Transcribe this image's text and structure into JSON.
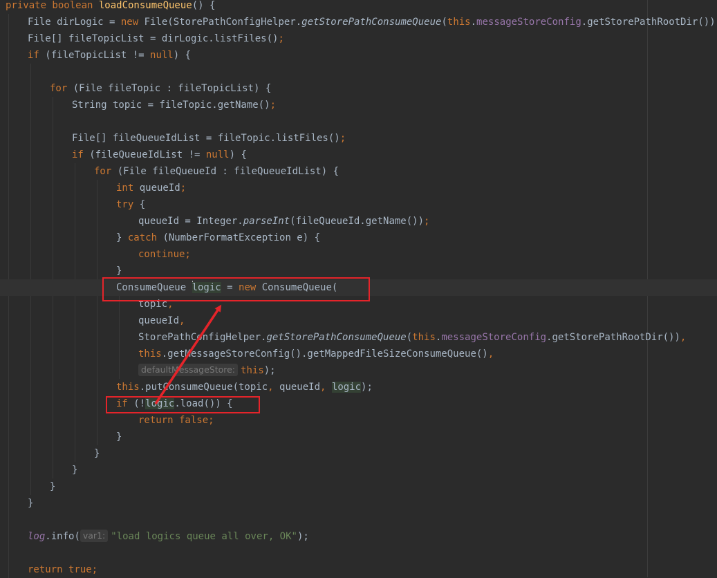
{
  "editor": {
    "lines": [
      {
        "indent": 0,
        "tokens": [
          [
            "private boolean ",
            "kw"
          ],
          [
            "loadConsumeQueue",
            "fn"
          ],
          [
            "() {",
            ""
          ]
        ]
      },
      {
        "indent": 1,
        "tokens": [
          [
            "File dirLogic = ",
            ""
          ],
          [
            "new ",
            "kw"
          ],
          [
            "File(StorePathConfigHelper.",
            ""
          ],
          [
            "getStorePathConsumeQueue",
            "it"
          ],
          [
            "(",
            ""
          ],
          [
            "this",
            "kw"
          ],
          [
            ".",
            ""
          ],
          [
            "messageStoreConfig",
            "fld"
          ],
          [
            ".getStorePathRootDir()));",
            ""
          ]
        ]
      },
      {
        "indent": 1,
        "tokens": [
          [
            "File[] fileTopicList = dirLogic.listFiles()",
            ""
          ],
          [
            ";",
            "kw"
          ]
        ]
      },
      {
        "indent": 1,
        "tokens": [
          [
            "if ",
            "kw"
          ],
          [
            "(fileTopicList != ",
            ""
          ],
          [
            "null",
            "kw"
          ],
          [
            ") {",
            ""
          ]
        ]
      },
      {
        "indent": 0,
        "tokens": []
      },
      {
        "indent": 2,
        "tokens": [
          [
            "for ",
            "kw"
          ],
          [
            "(File fileTopic : fileTopicList) {",
            ""
          ]
        ]
      },
      {
        "indent": 3,
        "tokens": [
          [
            "String topic = fileTopic.getName()",
            ""
          ],
          [
            ";",
            "kw"
          ]
        ]
      },
      {
        "indent": 0,
        "tokens": []
      },
      {
        "indent": 3,
        "tokens": [
          [
            "File[] fileQueueIdList = fileTopic.listFiles()",
            ""
          ],
          [
            ";",
            "kw"
          ]
        ]
      },
      {
        "indent": 3,
        "tokens": [
          [
            "if ",
            "kw"
          ],
          [
            "(fileQueueIdList != ",
            ""
          ],
          [
            "null",
            "kw"
          ],
          [
            ") {",
            ""
          ]
        ]
      },
      {
        "indent": 4,
        "tokens": [
          [
            "for ",
            "kw"
          ],
          [
            "(File fileQueueId : fileQueueIdList) {",
            ""
          ]
        ]
      },
      {
        "indent": 5,
        "tokens": [
          [
            "int ",
            "kw"
          ],
          [
            "queueId",
            ""
          ],
          [
            ";",
            "kw"
          ]
        ]
      },
      {
        "indent": 5,
        "tokens": [
          [
            "try ",
            "kw"
          ],
          [
            "{",
            ""
          ]
        ]
      },
      {
        "indent": 6,
        "tokens": [
          [
            "queueId = Integer.",
            ""
          ],
          [
            "parseInt",
            "it"
          ],
          [
            "(fileQueueId.getName())",
            ""
          ],
          [
            ";",
            "kw"
          ]
        ]
      },
      {
        "indent": 5,
        "tokens": [
          [
            "} ",
            ""
          ],
          [
            "catch ",
            "kw"
          ],
          [
            "(NumberFormatException e) {",
            ""
          ]
        ]
      },
      {
        "indent": 6,
        "tokens": [
          [
            "continue;",
            "kw"
          ]
        ]
      },
      {
        "indent": 5,
        "tokens": [
          [
            "}",
            ""
          ]
        ]
      },
      {
        "indent": 5,
        "current": true,
        "tokens": [
          [
            "ConsumeQueue ",
            ""
          ],
          [
            "",
            "caret"
          ],
          [
            "logic",
            "hl-var"
          ],
          [
            " = ",
            ""
          ],
          [
            "new ",
            "kw"
          ],
          [
            "ConsumeQueue(",
            ""
          ]
        ]
      },
      {
        "indent": 6,
        "tokens": [
          [
            "topic",
            ""
          ],
          [
            ",",
            "kw"
          ]
        ]
      },
      {
        "indent": 6,
        "tokens": [
          [
            "queueId",
            ""
          ],
          [
            ",",
            "kw"
          ]
        ]
      },
      {
        "indent": 6,
        "tokens": [
          [
            "StorePathConfigHelper.",
            ""
          ],
          [
            "getStorePathConsumeQueue",
            "it"
          ],
          [
            "(",
            ""
          ],
          [
            "this",
            "kw"
          ],
          [
            ".",
            ""
          ],
          [
            "messageStoreConfig",
            "fld"
          ],
          [
            ".getStorePathRootDir())",
            ""
          ],
          [
            ",",
            "kw"
          ]
        ]
      },
      {
        "indent": 6,
        "tokens": [
          [
            "this",
            "kw"
          ],
          [
            ".getMessageStoreConfig().getMappedFileSizeConsumeQueue()",
            ""
          ],
          [
            ",",
            "kw"
          ]
        ]
      },
      {
        "indent": 6,
        "tokens": [
          [
            "defaultMessageStore:",
            "hint"
          ],
          [
            "this",
            "kw"
          ],
          [
            ");",
            ""
          ]
        ]
      },
      {
        "indent": 5,
        "tokens": [
          [
            "this",
            "kw"
          ],
          [
            ".putConsumeQueue(topic",
            ""
          ],
          [
            ", ",
            "kw"
          ],
          [
            "queueId",
            ""
          ],
          [
            ", ",
            "kw"
          ],
          [
            "logic",
            "hl-var"
          ],
          [
            ");",
            ""
          ]
        ]
      },
      {
        "indent": 5,
        "tokens": [
          [
            "if ",
            "kw"
          ],
          [
            "(!",
            ""
          ],
          [
            "logic",
            "hl-var"
          ],
          [
            ".load()) {",
            ""
          ]
        ]
      },
      {
        "indent": 6,
        "tokens": [
          [
            "return false;",
            "kw"
          ]
        ]
      },
      {
        "indent": 5,
        "tokens": [
          [
            "}",
            ""
          ]
        ]
      },
      {
        "indent": 4,
        "tokens": [
          [
            "}",
            ""
          ]
        ]
      },
      {
        "indent": 3,
        "tokens": [
          [
            "}",
            ""
          ]
        ]
      },
      {
        "indent": 2,
        "tokens": [
          [
            "}",
            ""
          ]
        ]
      },
      {
        "indent": 1,
        "tokens": [
          [
            "}",
            ""
          ]
        ]
      },
      {
        "indent": 0,
        "tokens": []
      },
      {
        "indent": 1,
        "tokens": [
          [
            "log",
            "fld it"
          ],
          [
            ".info(",
            ""
          ],
          [
            "var1:",
            "hint"
          ],
          [
            "\"load logics queue all over, OK\"",
            "str"
          ],
          [
            ");",
            ""
          ]
        ]
      },
      {
        "indent": 0,
        "tokens": []
      },
      {
        "indent": 1,
        "tokens": [
          [
            "return true;",
            "kw"
          ]
        ]
      }
    ]
  },
  "colors": {
    "background": "#2b2b2b",
    "keyword": "#cc7832",
    "method_decl": "#ffc66d",
    "field": "#9876aa",
    "string": "#6a8759",
    "annotation_red": "#e5242a"
  }
}
